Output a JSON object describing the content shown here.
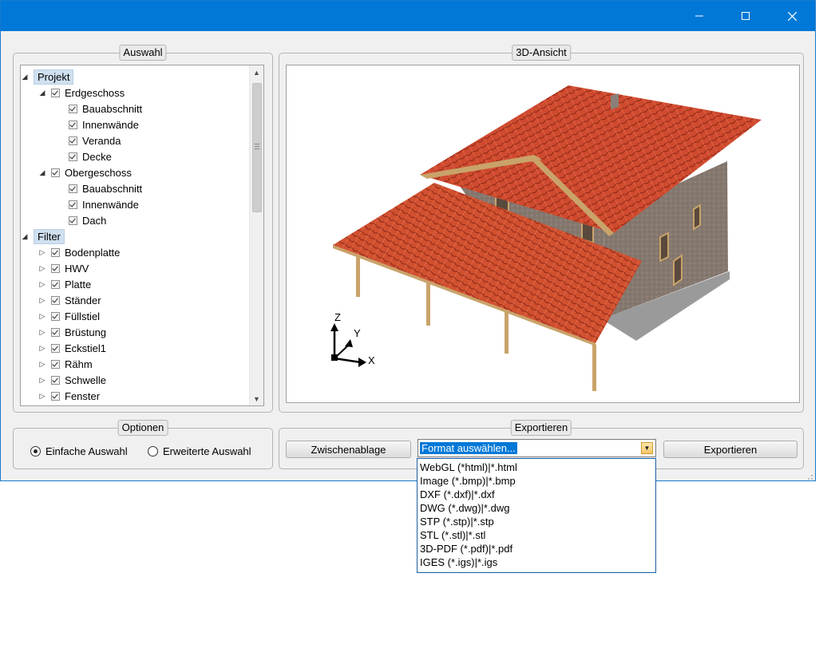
{
  "window": {
    "controls": {
      "minimize_icon": "–",
      "maximize_icon": "☐",
      "close_icon": "✕"
    }
  },
  "auswahl": {
    "title": "Auswahl",
    "tree": [
      {
        "label": "Projekt",
        "level": 0,
        "expander": "◢",
        "checkbox": false,
        "highlight": true
      },
      {
        "label": "Erdgeschoss",
        "level": 1,
        "expander": "◢",
        "checkbox": true
      },
      {
        "label": "Bauabschnitt",
        "level": 2,
        "expander": "",
        "checkbox": true
      },
      {
        "label": "Innenwände",
        "level": 2,
        "expander": "",
        "checkbox": true
      },
      {
        "label": "Veranda",
        "level": 2,
        "expander": "",
        "checkbox": true
      },
      {
        "label": "Decke",
        "level": 2,
        "expander": "",
        "checkbox": true
      },
      {
        "label": "Obergeschoss",
        "level": 1,
        "expander": "◢",
        "checkbox": true
      },
      {
        "label": "Bauabschnitt",
        "level": 2,
        "expander": "",
        "checkbox": true
      },
      {
        "label": "Innenwände",
        "level": 2,
        "expander": "",
        "checkbox": true
      },
      {
        "label": "Dach",
        "level": 2,
        "expander": "",
        "checkbox": true
      },
      {
        "label": "Filter",
        "level": 0,
        "expander": "◢",
        "checkbox": false,
        "highlight": true
      },
      {
        "label": "Bodenplatte",
        "level": 1,
        "expander": "▷",
        "checkbox": true
      },
      {
        "label": "HWV",
        "level": 1,
        "expander": "▷",
        "checkbox": true
      },
      {
        "label": "Platte",
        "level": 1,
        "expander": "▷",
        "checkbox": true
      },
      {
        "label": "Ständer",
        "level": 1,
        "expander": "▷",
        "checkbox": true
      },
      {
        "label": "Füllstiel",
        "level": 1,
        "expander": "▷",
        "checkbox": true
      },
      {
        "label": "Brüstung",
        "level": 1,
        "expander": "▷",
        "checkbox": true
      },
      {
        "label": "Eckstiel1",
        "level": 1,
        "expander": "▷",
        "checkbox": true
      },
      {
        "label": "Rähm",
        "level": 1,
        "expander": "▷",
        "checkbox": true
      },
      {
        "label": "Schwelle",
        "level": 1,
        "expander": "▷",
        "checkbox": true
      },
      {
        "label": "Fenster",
        "level": 1,
        "expander": "▷",
        "checkbox": true
      }
    ]
  },
  "ansicht": {
    "title": "3D-Ansicht",
    "axes": {
      "z": "Z",
      "y": "Y",
      "x": "X"
    }
  },
  "optionen": {
    "title": "Optionen",
    "radio_simple": "Einfache Auswahl",
    "radio_extended": "Erweiterte Auswahl",
    "selected": "simple"
  },
  "exportieren": {
    "title": "Exportieren",
    "clipboard_button": "Zwischenablage",
    "format_selected": "Format auswählen...",
    "export_button": "Exportieren",
    "format_options": [
      "WebGL (*html)|*.html",
      "Image (*.bmp)|*.bmp",
      "DXF (*.dxf)|*.dxf",
      "DWG (*.dwg)|*.dwg",
      "STP (*.stp)|*.stp",
      "STL (*.stl)|*.stl",
      "3D-PDF (*.pdf)|*.pdf",
      "IGES (*.igs)|*.igs"
    ]
  },
  "colors": {
    "titlebar": "#0078d7",
    "roof": "#c8402a",
    "wall": "#8a8079",
    "post": "#c9a36a"
  }
}
